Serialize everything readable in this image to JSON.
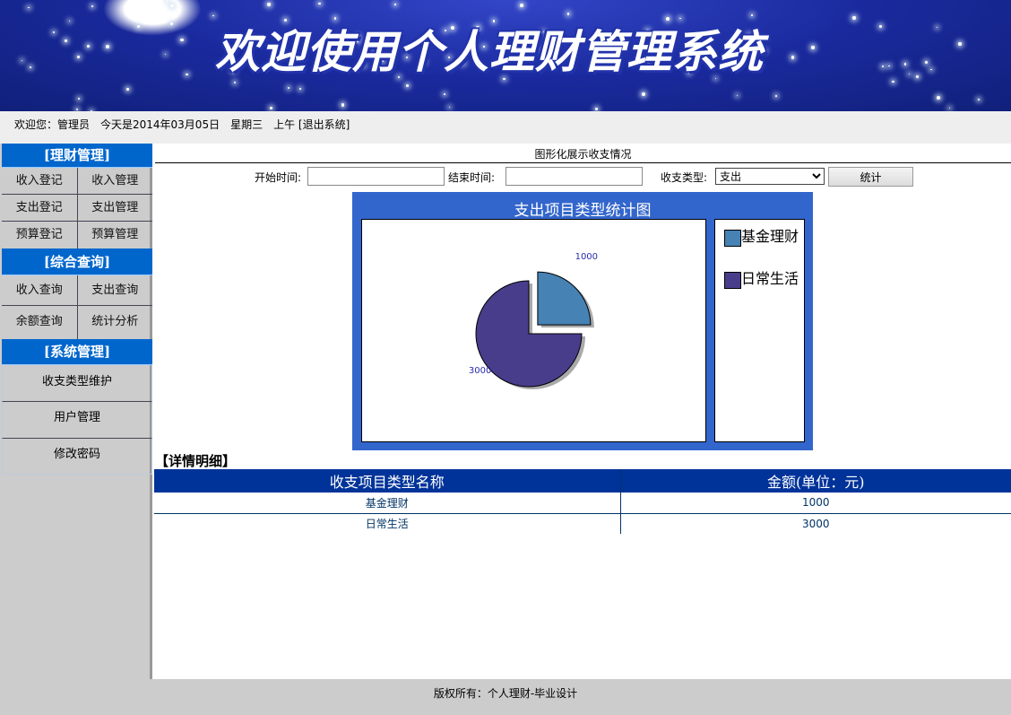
{
  "banner": {
    "title": "欢迎使用个人理财管理系统"
  },
  "welcome": {
    "text": "欢迎您：管理员　今天是2014年03月05日　星期三　上午 [退出系统]"
  },
  "sidebar": {
    "sections": [
      {
        "title": "[理财管理]",
        "items": [
          "收入登记",
          "收入管理",
          "支出登记",
          "支出管理",
          "预算登记",
          "预算管理"
        ]
      },
      {
        "title": "[综合查询]",
        "items": [
          "收入查询",
          "支出查询",
          "余额查询",
          "统计分析"
        ]
      },
      {
        "title": "[系统管理]",
        "items": [
          "收支类型维护",
          "用户管理",
          "修改密码"
        ]
      }
    ]
  },
  "main": {
    "title": "图形化展示收支情况",
    "form": {
      "start_label": "开始时间:",
      "start_value": "",
      "end_label": "结束时间:",
      "end_value": "",
      "type_label": "收支类型:",
      "type_value": "支出",
      "submit": "统计"
    },
    "detail_label": "【详情明细】",
    "table": {
      "headers": [
        "收支项目类型名称",
        "金额(单位：元)"
      ],
      "rows": [
        [
          "基金理财",
          "1000"
        ],
        [
          "日常生活",
          "3000"
        ]
      ]
    }
  },
  "chart_data": {
    "type": "pie",
    "title": "支出项目类型统计图",
    "categories": [
      "基金理财",
      "日常生活"
    ],
    "values": [
      1000,
      3000
    ],
    "colors": [
      "#4682b4",
      "#483d8b"
    ],
    "legend": "right"
  },
  "footer": {
    "text": "版权所有：个人理财-毕业设计"
  }
}
